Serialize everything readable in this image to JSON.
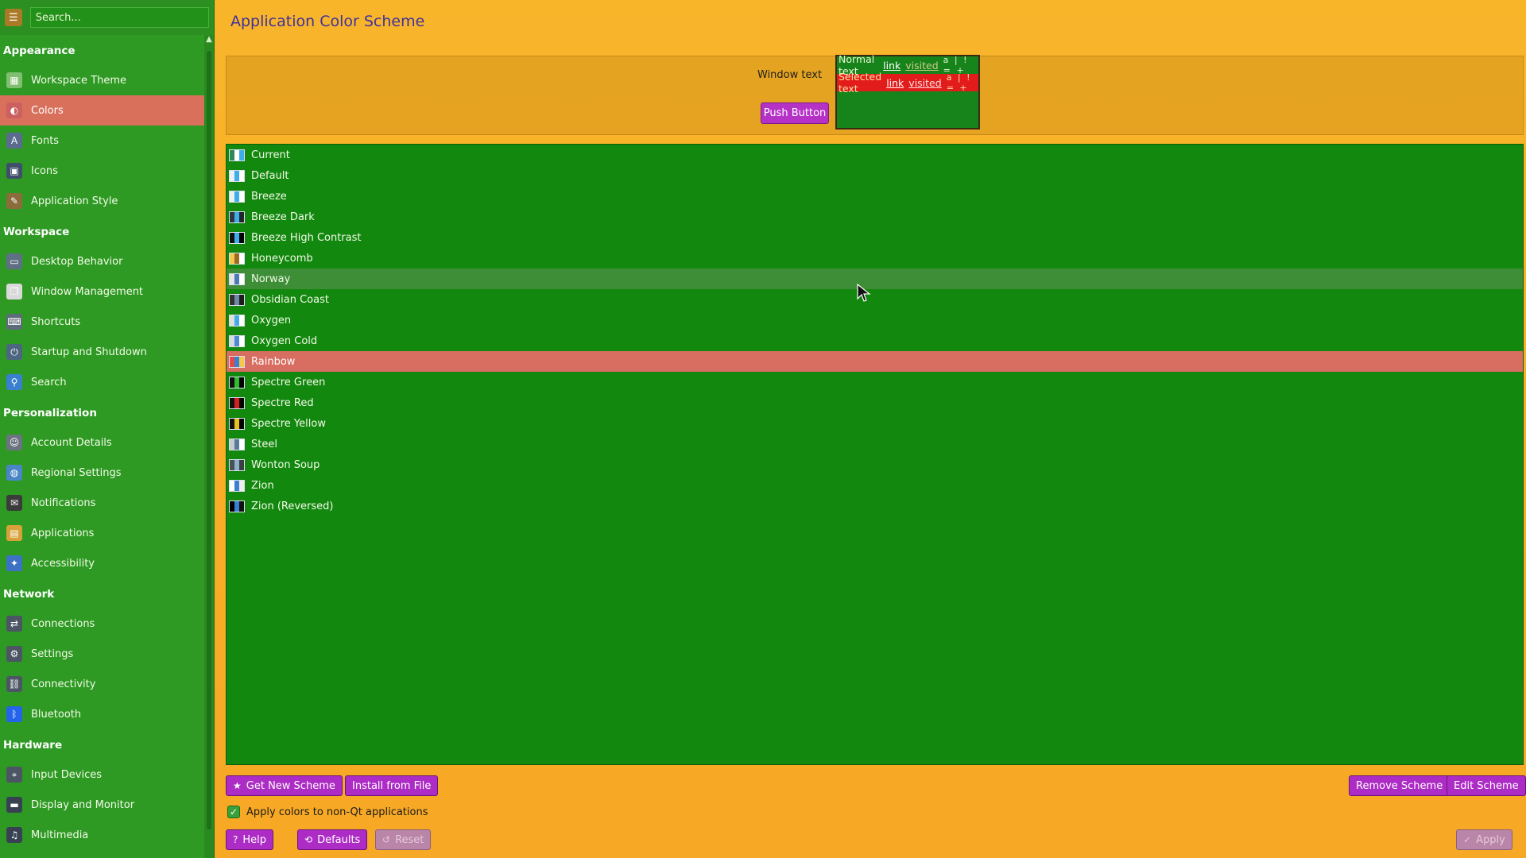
{
  "search": {
    "placeholder": "Search..."
  },
  "sidebar": {
    "sections": [
      {
        "title": "Appearance",
        "items": [
          {
            "label": "Workspace Theme",
            "icon": "workspace-theme-icon",
            "color": "#7fbf6f"
          },
          {
            "label": "Colors",
            "icon": "colors-icon",
            "color": "#cc6060",
            "active": true
          },
          {
            "label": "Fonts",
            "icon": "fonts-icon",
            "color": "#5a6b8f"
          },
          {
            "label": "Icons",
            "icon": "icons-icon",
            "color": "#3f4e6a"
          },
          {
            "label": "Application Style",
            "icon": "application-style-icon",
            "color": "#8a6d3b"
          }
        ]
      },
      {
        "title": "Workspace",
        "items": [
          {
            "label": "Desktop Behavior",
            "icon": "desktop-behavior-icon",
            "color": "#5f6f84"
          },
          {
            "label": "Window Management",
            "icon": "window-management-icon",
            "color": "#d9d9d9"
          },
          {
            "label": "Shortcuts",
            "icon": "shortcuts-icon",
            "color": "#5d6b7b"
          },
          {
            "label": "Startup and Shutdown",
            "icon": "startup-shutdown-icon",
            "color": "#4d6680"
          },
          {
            "label": "Search",
            "icon": "search-icon",
            "color": "#3a7fd0"
          }
        ]
      },
      {
        "title": "Personalization",
        "items": [
          {
            "label": "Account Details",
            "icon": "account-details-icon",
            "color": "#6b7280"
          },
          {
            "label": "Regional Settings",
            "icon": "regional-settings-icon",
            "color": "#4a86c5"
          },
          {
            "label": "Notifications",
            "icon": "notifications-icon",
            "color": "#3b3b3b"
          },
          {
            "label": "Applications",
            "icon": "applications-icon",
            "color": "#d7a23a"
          },
          {
            "label": "Accessibility",
            "icon": "accessibility-icon",
            "color": "#3c72c4"
          }
        ]
      },
      {
        "title": "Network",
        "items": [
          {
            "label": "Connections",
            "icon": "connections-icon",
            "color": "#4b5563"
          },
          {
            "label": "Settings",
            "icon": "network-settings-icon",
            "color": "#4b5563"
          },
          {
            "label": "Connectivity",
            "icon": "connectivity-icon",
            "color": "#4b5563"
          },
          {
            "label": "Bluetooth",
            "icon": "bluetooth-icon",
            "color": "#2563eb"
          }
        ]
      },
      {
        "title": "Hardware",
        "items": [
          {
            "label": "Input Devices",
            "icon": "input-devices-icon",
            "color": "#4b5563"
          },
          {
            "label": "Display and Monitor",
            "icon": "display-monitor-icon",
            "color": "#374151"
          },
          {
            "label": "Multimedia",
            "icon": "multimedia-icon",
            "color": "#374151"
          }
        ]
      }
    ]
  },
  "main": {
    "title": "Application Color Scheme",
    "preview": {
      "window_text": "Window text",
      "push_button": "Push Button",
      "normal_text": "Normal text",
      "selected_text": "Selected text",
      "link": "link",
      "visited": "visited",
      "marks": "a | ! = +"
    },
    "schemes": [
      {
        "name": "Current",
        "swatch": [
          "#2e8b57",
          "#ffffff",
          "#3daee9"
        ]
      },
      {
        "name": "Default",
        "swatch": [
          "#eff0f1",
          "#3daee9",
          "#ffffff"
        ]
      },
      {
        "name": "Breeze",
        "swatch": [
          "#eff0f1",
          "#3daee9",
          "#ffffff"
        ]
      },
      {
        "name": "Breeze Dark",
        "swatch": [
          "#31363b",
          "#3daee9",
          "#232629"
        ]
      },
      {
        "name": "Breeze High Contrast",
        "swatch": [
          "#111111",
          "#3daee9",
          "#000000"
        ]
      },
      {
        "name": "Honeycomb",
        "swatch": [
          "#f5c84c",
          "#9a6b20",
          "#ffffff"
        ]
      },
      {
        "name": "Norway",
        "swatch": [
          "#e6e6e6",
          "#4a7ab8",
          "#ffffff"
        ]
      },
      {
        "name": "Obsidian Coast",
        "swatch": [
          "#313131",
          "#6e8aa6",
          "#1d1d1d"
        ]
      },
      {
        "name": "Oxygen",
        "swatch": [
          "#e0dfd8",
          "#43ace8",
          "#ffffff"
        ]
      },
      {
        "name": "Oxygen Cold",
        "swatch": [
          "#d6dbe3",
          "#4d8ad1",
          "#ffffff"
        ]
      },
      {
        "name": "Rainbow",
        "swatch": [
          "#e34a4a",
          "#3a7fd0",
          "#f5c84c"
        ]
      },
      {
        "name": "Spectre Green",
        "swatch": [
          "#101010",
          "#2ebd2e",
          "#000000"
        ]
      },
      {
        "name": "Spectre Red",
        "swatch": [
          "#101010",
          "#d22020",
          "#000000"
        ]
      },
      {
        "name": "Spectre Yellow",
        "swatch": [
          "#101010",
          "#e6c020",
          "#000000"
        ]
      },
      {
        "name": "Steel",
        "swatch": [
          "#c8ccd0",
          "#5a7a9a",
          "#ffffff"
        ]
      },
      {
        "name": "Wonton Soup",
        "swatch": [
          "#4a5058",
          "#8db2c7",
          "#3a3f46"
        ]
      },
      {
        "name": "Zion",
        "swatch": [
          "#ffffff",
          "#3a7fd0",
          "#eeeeee"
        ]
      },
      {
        "name": "Zion (Reversed)",
        "swatch": [
          "#000000",
          "#3a7fd0",
          "#111111"
        ]
      }
    ],
    "selected_scheme": "Rainbow",
    "hover_scheme": "Norway",
    "buttons": {
      "get_new": "Get New Scheme",
      "install": "Install from File",
      "remove": "Remove Scheme",
      "edit": "Edit Scheme",
      "help": "Help",
      "defaults": "Defaults",
      "reset": "Reset",
      "apply": "Apply"
    },
    "apply_non_qt": "Apply colors to non-Qt applications"
  },
  "colors": {
    "sidebar_bg": "#2e9a24",
    "list_bg": "#13880f",
    "selection": "#d86d61",
    "button": "#ad2cc5",
    "window_bg": "#f8b52a",
    "title": "#40329c"
  }
}
